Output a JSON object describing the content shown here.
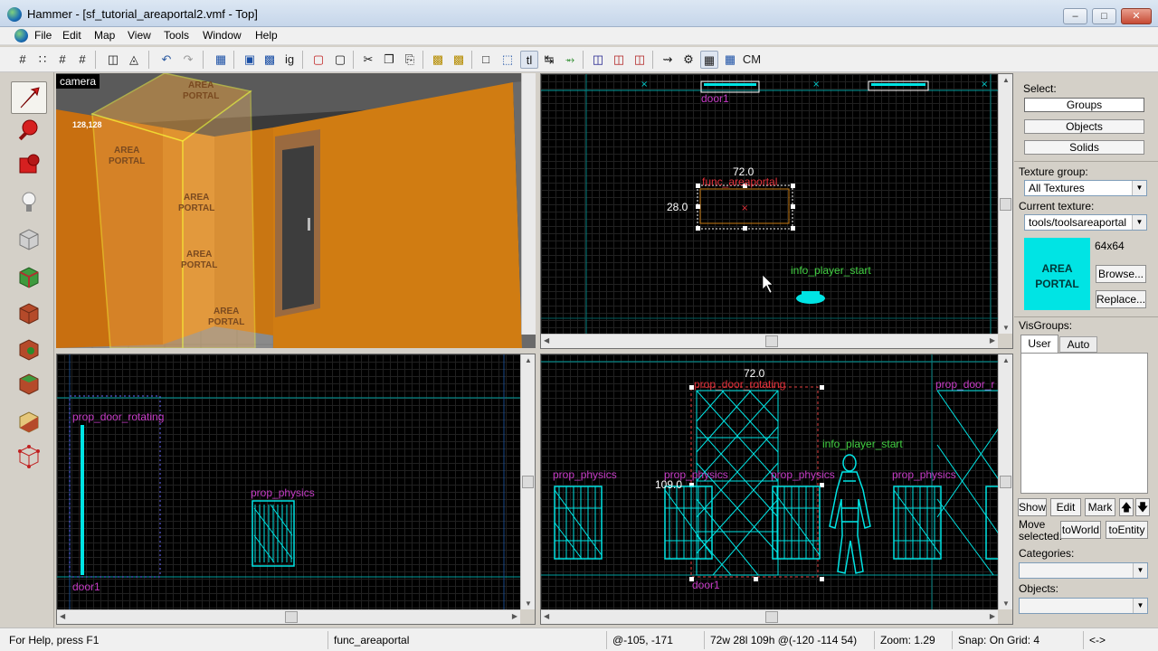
{
  "window": {
    "title": "Hammer - [sf_tutorial_areaportal2.vmf - Top]",
    "controls": [
      "0",
      "1",
      "r"
    ]
  },
  "menu": [
    "File",
    "Edit",
    "Map",
    "View",
    "Tools",
    "Window",
    "Help"
  ],
  "mdi_controls": [
    "_",
    "□",
    "×"
  ],
  "toolbar": {
    "icon_names": [
      "grid-toggle",
      "grid-dots",
      "grid-smaller",
      "grid-larger",
      "group",
      "ungroup",
      "undo",
      "redo",
      "carve",
      "hollow",
      "texture-app",
      "cut",
      "copy",
      "paste",
      "hide",
      "show",
      "select-box",
      "select-objects",
      "texture-lock",
      "flip",
      "rotate",
      "clip",
      "vertex",
      "decal",
      "cordon",
      "run-map",
      "compile",
      "cm-label"
    ],
    "tl_label": "tl",
    "ig_label": "ig",
    "cm_label": "CM"
  },
  "views": {
    "camera": {
      "label": "camera",
      "texture_text": [
        "AREA",
        "PORTAL"
      ],
      "wall_sign": "128,128"
    },
    "top": {
      "labels": {
        "door": "door1",
        "func": "func_areaportal",
        "player": "info_player_start"
      },
      "dims": {
        "width": "72.0",
        "height": "28.0"
      }
    },
    "side": {
      "labels": {
        "door_rot": "prop_door_rotating",
        "door": "door1",
        "physics": "prop_physics"
      }
    },
    "front": {
      "labels": {
        "door_rot": "prop_door_rotating",
        "door_rot_right": "prop_door_r",
        "player": "info_player_start",
        "physics": "prop_physics",
        "door": "door1"
      },
      "dims": {
        "width": "72.0",
        "height": "109.0"
      }
    }
  },
  "right_panel": {
    "select_label": "Select:",
    "select_buttons": [
      "Groups",
      "Objects",
      "Solids"
    ],
    "texture_group_label": "Texture group:",
    "texture_group_value": "All Textures",
    "current_texture_label": "Current texture:",
    "current_texture_value": "tools/toolsareaportal",
    "texture_size": "64x64",
    "texture_preview": [
      "AREA",
      "PORTAL"
    ],
    "browse": "Browse...",
    "replace": "Replace...",
    "visgroups_label": "VisGroups:",
    "tabs": [
      "User",
      "Auto"
    ],
    "buttons": [
      "Show",
      "Edit",
      "Mark"
    ],
    "move_selected_label": "Move selected:",
    "to_world": "toWorld",
    "to_entity": "toEntity",
    "categories_label": "Categories:",
    "objects_label": "Objects:"
  },
  "status": {
    "help": "For Help, press F1",
    "selection": "func_areaportal",
    "coords": "@-105, -171",
    "size": "72w 28l 109h @(-120 -114 54)",
    "zoom": "Zoom: 1.29",
    "snap": "Snap: On Grid: 4",
    "nudge": "<->"
  },
  "colors": {
    "accent": "#00e4e4",
    "entity_label": "#c63cc6",
    "player_label": "#42d042",
    "wall": "#d68012"
  }
}
